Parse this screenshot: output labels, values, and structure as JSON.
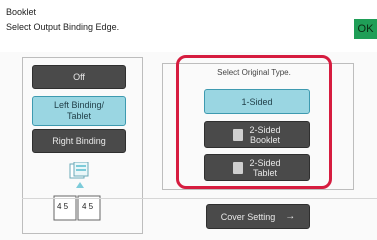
{
  "header": {
    "title": "Booklet",
    "subtitle": "Select Output Binding Edge.",
    "ok_label": "OK"
  },
  "binding": {
    "options": [
      "Off",
      "Left Binding/\nTablet",
      "Right Binding"
    ],
    "selected": 1
  },
  "original_type": {
    "label": "Select Original Type.",
    "options": [
      "1-Sided",
      "2-Sided\nBooklet",
      "2-Sided\nTablet"
    ],
    "selected": 0
  },
  "footer": {
    "cover_label": "Cover Setting"
  },
  "preview": {
    "page_left": "4 5",
    "page_right": "4 5"
  },
  "colors": {
    "ok": "#1f9e57",
    "accent": "#3e9ab0",
    "highlight": "#d61c3f"
  }
}
